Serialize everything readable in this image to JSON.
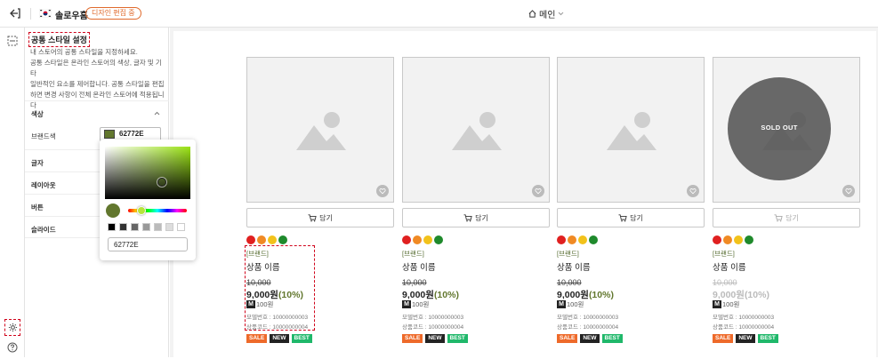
{
  "header": {
    "store_name": "솔로우홈",
    "store_badge": "디자인 편집 중",
    "page_select": "메인",
    "exit_icon": "exit-icon",
    "page_icon": "home-icon"
  },
  "panel": {
    "title": "공통 스타일 설정",
    "description": [
      "내 스토어의 공통 스타일을 지정하세요.",
      "공통 스타일은 온라인 스토어의 색상, 글자 및 기타",
      "일반적인 요소를 제어합니다. 공통 스타일을 편집",
      "하면 변경 사항이 전체 온라인 스토어에 적용됩니",
      "다"
    ],
    "sections": {
      "color": "색상",
      "text": "글자",
      "layout": "레이아웃",
      "button": "버튼",
      "slider": "슬라이드"
    },
    "brand_color_label": "브랜드색",
    "brand_color_value": "62772E"
  },
  "picker": {
    "hex_value": "62772E",
    "presets": [
      "#000000",
      "#333333",
      "#666666",
      "#999999",
      "#bbbbbb",
      "#dddddd",
      "#ffffff"
    ]
  },
  "colors": {
    "brand": "#62772e",
    "dashed_highlight": "#d0021b",
    "sale": "#ee6a2a",
    "new": "#222222",
    "best": "#1fb86a"
  },
  "products": [
    {
      "sold_out": false,
      "cart_label": "담기",
      "swatches": [
        "#e02020",
        "#f08a24",
        "#f2c21b",
        "#1f8a2c"
      ],
      "brand": "[브랜드]",
      "name": "상품 이름",
      "original_price": "10,000",
      "price": "9,000원",
      "discount": "(10%)",
      "point_badge": "M",
      "point": "100원",
      "model": "모델번호 : 10000000003",
      "code": "상품코드 : 10000000004",
      "tags": [
        "SALE",
        "NEW",
        "BEST"
      ]
    },
    {
      "sold_out": false,
      "cart_label": "담기",
      "swatches": [
        "#e02020",
        "#f08a24",
        "#f2c21b",
        "#1f8a2c"
      ],
      "brand": "[브랜드]",
      "name": "상품 이름",
      "original_price": "10,000",
      "price": "9,000원",
      "discount": "(10%)",
      "point_badge": "M",
      "point": "100원",
      "model": "모델번호 : 10000000003",
      "code": "상품코드 : 10000000004",
      "tags": [
        "SALE",
        "NEW",
        "BEST"
      ]
    },
    {
      "sold_out": false,
      "cart_label": "담기",
      "swatches": [
        "#e02020",
        "#f08a24",
        "#f2c21b",
        "#1f8a2c"
      ],
      "brand": "[브랜드]",
      "name": "상품 이름",
      "original_price": "10,000",
      "price": "9,000원",
      "discount": "(10%)",
      "point_badge": "M",
      "point": "100원",
      "model": "모델번호 : 10000000003",
      "code": "상품코드 : 10000000004",
      "tags": [
        "SALE",
        "NEW",
        "BEST"
      ]
    },
    {
      "sold_out": true,
      "sold_out_label": "SOLD OUT",
      "cart_label": "담기",
      "swatches": [
        "#e02020",
        "#f08a24",
        "#f2c21b",
        "#1f8a2c"
      ],
      "brand": "[브랜드]",
      "name": "상품 이름",
      "original_price": "10,000",
      "price": "9,000원",
      "discount": "(10%)",
      "point_badge": "M",
      "point": "100원",
      "model": "모델번호 : 10000000003",
      "code": "상품코드 : 10000000004",
      "tags": [
        "SALE",
        "NEW",
        "BEST"
      ]
    }
  ]
}
